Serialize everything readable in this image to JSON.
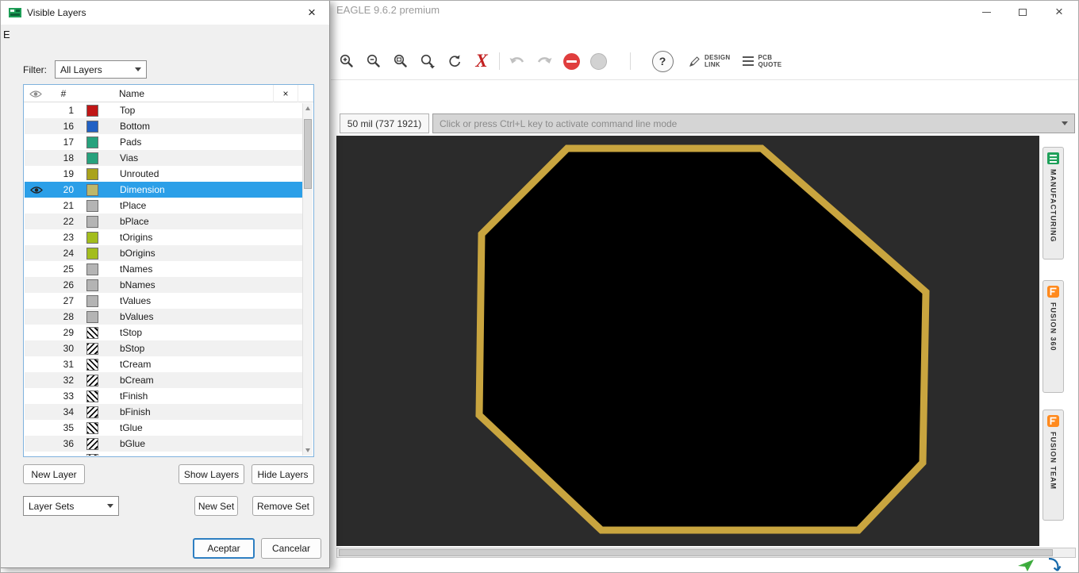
{
  "main_window": {
    "title": "EAGLE 9.6.2 premium",
    "stray_letter": "E",
    "window_controls": {
      "close_glyph": "×"
    },
    "toolbar": {
      "cancel_x": "X",
      "help": "?",
      "design_link": {
        "line1": "DESIGN",
        "line2": "LINK"
      },
      "pcb_quote": {
        "line1": "PCB",
        "line2": "QUOTE"
      }
    },
    "command_bar": {
      "coordinates": "50 mil (737 1921)",
      "placeholder": "Click or press Ctrl+L key to activate command line mode"
    },
    "side_tabs": [
      {
        "label": "MANUFACTURING",
        "icon_color": "#1fa05a"
      },
      {
        "label": "FUSION 360",
        "icon_color": "#ff8a1e"
      },
      {
        "label": "FUSION TEAM",
        "icon_color": "#ff8a1e"
      }
    ],
    "colors": {
      "canvas_bg": "#2b2b2b",
      "octagon_stroke": "#c9a53f",
      "octagon_fill": "#000000",
      "stop_red": "#e03e3e",
      "title_text": "#9b9b9b"
    }
  },
  "dialog": {
    "title": "Visible Layers",
    "filter_label": "Filter:",
    "filter_value": "All Layers",
    "table": {
      "header_number": "#",
      "header_name": "Name",
      "header_close": "×",
      "rows": [
        {
          "num": "1",
          "name": "Top",
          "color": "#c01616",
          "pattern": "solid",
          "selected": false,
          "visible": false
        },
        {
          "num": "16",
          "name": "Bottom",
          "color": "#2261c4",
          "pattern": "solid",
          "selected": false,
          "visible": false
        },
        {
          "num": "17",
          "name": "Pads",
          "color": "#27a27d",
          "pattern": "solid",
          "selected": false,
          "visible": false
        },
        {
          "num": "18",
          "name": "Vias",
          "color": "#27a27d",
          "pattern": "solid",
          "selected": false,
          "visible": false
        },
        {
          "num": "19",
          "name": "Unrouted",
          "color": "#aaa31b",
          "pattern": "solid",
          "selected": false,
          "visible": false
        },
        {
          "num": "20",
          "name": "Dimension",
          "color": "#bdb76b",
          "pattern": "solid",
          "selected": true,
          "visible": true
        },
        {
          "num": "21",
          "name": "tPlace",
          "color": "#b4b4b4",
          "pattern": "solid",
          "selected": false,
          "visible": false
        },
        {
          "num": "22",
          "name": "bPlace",
          "color": "#b4b4b4",
          "pattern": "solid",
          "selected": false,
          "visible": false
        },
        {
          "num": "23",
          "name": "tOrigins",
          "color": "#a3bd1d",
          "pattern": "solid",
          "selected": false,
          "visible": false
        },
        {
          "num": "24",
          "name": "bOrigins",
          "color": "#a3bd1d",
          "pattern": "solid",
          "selected": false,
          "visible": false
        },
        {
          "num": "25",
          "name": "tNames",
          "color": "#b4b4b4",
          "pattern": "solid",
          "selected": false,
          "visible": false
        },
        {
          "num": "26",
          "name": "bNames",
          "color": "#b4b4b4",
          "pattern": "solid",
          "selected": false,
          "visible": false
        },
        {
          "num": "27",
          "name": "tValues",
          "color": "#b4b4b4",
          "pattern": "solid",
          "selected": false,
          "visible": false
        },
        {
          "num": "28",
          "name": "bValues",
          "color": "#b4b4b4",
          "pattern": "solid",
          "selected": false,
          "visible": false
        },
        {
          "num": "29",
          "name": "tStop",
          "pattern": "hatch-right",
          "selected": false,
          "visible": false
        },
        {
          "num": "30",
          "name": "bStop",
          "pattern": "hatch-left",
          "selected": false,
          "visible": false
        },
        {
          "num": "31",
          "name": "tCream",
          "pattern": "hatch-right",
          "selected": false,
          "visible": false
        },
        {
          "num": "32",
          "name": "bCream",
          "pattern": "hatch-left",
          "selected": false,
          "visible": false
        },
        {
          "num": "33",
          "name": "tFinish",
          "pattern": "hatch-right",
          "selected": false,
          "visible": false
        },
        {
          "num": "34",
          "name": "bFinish",
          "pattern": "hatch-left",
          "selected": false,
          "visible": false
        },
        {
          "num": "35",
          "name": "tGlue",
          "pattern": "hatch-right",
          "selected": false,
          "visible": false
        },
        {
          "num": "36",
          "name": "bGlue",
          "pattern": "hatch-left",
          "selected": false,
          "visible": false
        }
      ],
      "partial_row": {
        "pattern": "hatch-right"
      }
    },
    "buttons": {
      "new_layer": "New Layer",
      "show_layers": "Show Layers",
      "hide_layers": "Hide Layers",
      "layer_sets": "Layer Sets",
      "new_set": "New Set",
      "remove_set": "Remove Set",
      "accept": "Aceptar",
      "cancel": "Cancelar"
    },
    "colors": {
      "selection": "#2b9fe8",
      "table_border": "#7fb2dd",
      "accept_border": "#2e7fc2"
    }
  }
}
